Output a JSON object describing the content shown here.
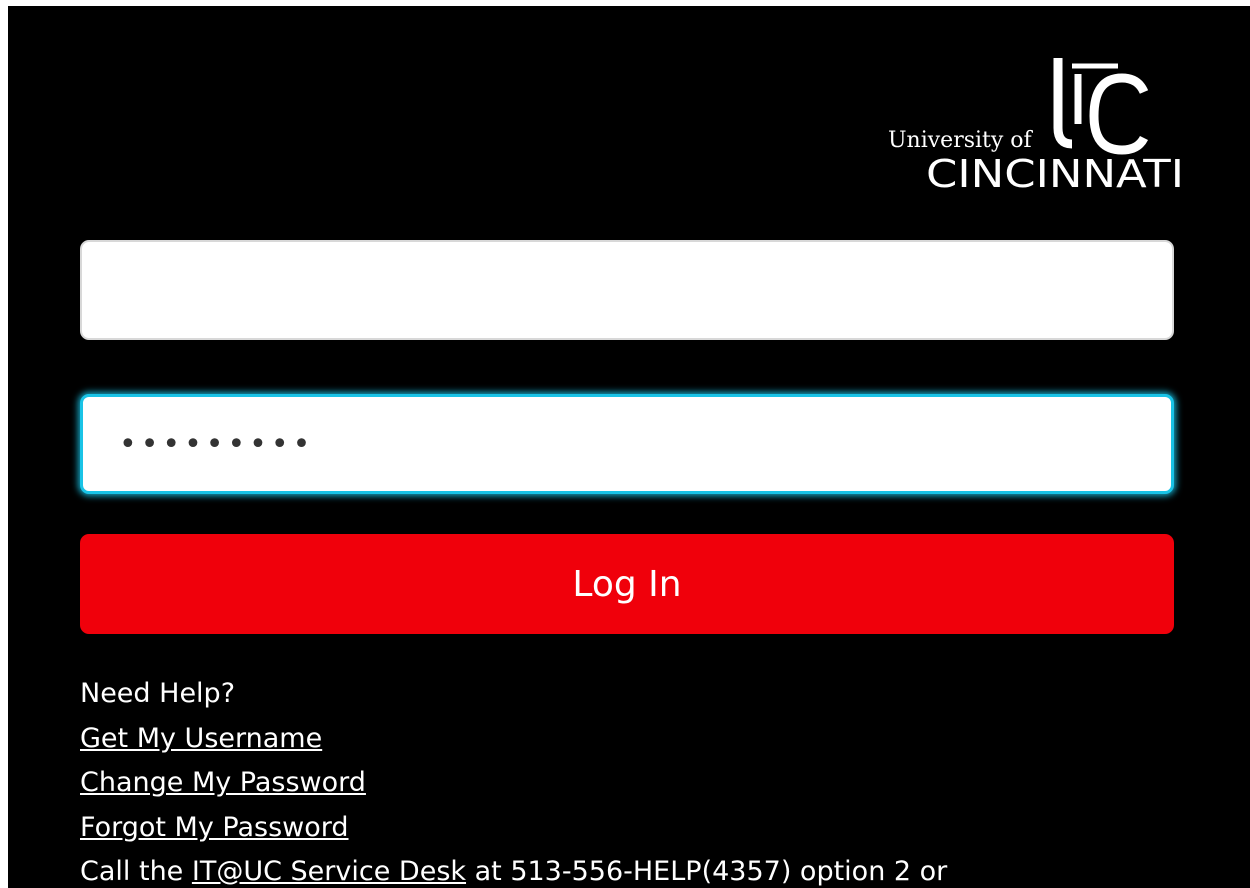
{
  "brand": {
    "logo_line1": "University of",
    "logo_line2": "CINCINNATI",
    "logo_mark": "UC"
  },
  "login_form": {
    "username_value": "",
    "password_value": "•••••••••",
    "submit_label": "Log In"
  },
  "help": {
    "heading": "Need Help?",
    "links": [
      "Get My Username",
      "Change My Password",
      "Forgot My Password"
    ],
    "contact_prefix": "Call the ",
    "contact_link": "IT@UC Service Desk",
    "contact_suffix": " at 513-556-HELP(4357) option 2 or"
  },
  "colors": {
    "background": "#000000",
    "button": "#f0000b",
    "focus_ring": "#19c3e6",
    "text": "#ffffff"
  }
}
